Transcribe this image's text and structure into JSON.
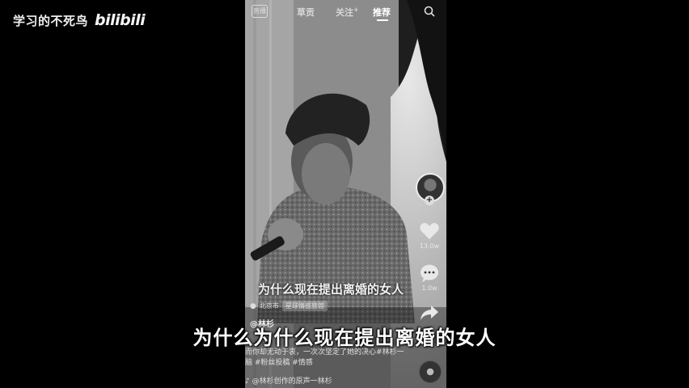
{
  "watermark": {
    "channel": "学习的不死鸟",
    "logo": "bilibili"
  },
  "nav": {
    "live": "直播",
    "items": [
      "草贡",
      "关注",
      "推荐"
    ],
    "follow_badge": "+",
    "active": "推荐"
  },
  "actions": {
    "likes": "13.0w",
    "comments": "1.0w",
    "avatar_plus": "+"
  },
  "video": {
    "in_video_subtitle": "为什么现在提出离婚的女人",
    "location": "北京市",
    "location_tag": "星球情感旅馆",
    "author": "@林杉",
    "description": "而你却无动于衷，一次次坚定了她的决心#林杉一脑 #粉丝投稿 #情感",
    "music": "♪ @林杉创作的原声一林杉"
  },
  "subtitle": "为什么为什么现在提出离婚的女人"
}
